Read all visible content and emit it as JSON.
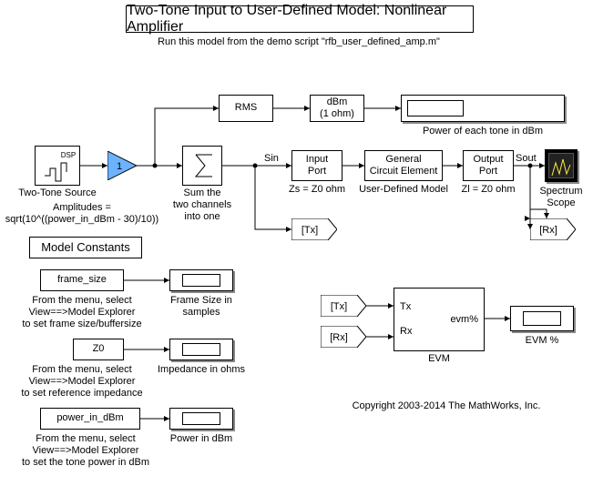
{
  "title": "Two-Tone Input to User-Defined Model: Nonlinear Amplifier",
  "subtitle": "Run this model from the demo script \"rfb_user_defined_amp.m\"",
  "blocks": {
    "twoTone": {
      "name": "Two-Tone Source",
      "note": "Amplitudes =\nsqrt(10^((power_in_dBm - 30)/10))",
      "badge": "DSP"
    },
    "gain": "1",
    "sum": {
      "name": "Sum the\ntwo channels\ninto one"
    },
    "rms": "RMS",
    "dbm": "dBm\n(1 ohm)",
    "dispPower": {
      "caption": "Power of each tone in dBm"
    },
    "inPort": {
      "name": "Input\nPort",
      "note": "Zs = Z0 ohm"
    },
    "ckt": {
      "name": "General\nCircuit Element",
      "note": "User-Defined Model"
    },
    "outPort": {
      "name": "Output\nPort",
      "note": "Zl = Z0 ohm"
    },
    "scope": {
      "name": "Spectrum\nScope"
    },
    "gotoTx": "[Tx]",
    "gotoRx": "[Rx]",
    "fromTx": "[Tx]",
    "fromRx": "[Rx]",
    "evm": {
      "name": "EVM",
      "tx": "Tx",
      "rx": "Rx",
      "out": "evm%"
    },
    "dispEvm": {
      "caption": "EVM %"
    },
    "sigSin": "Sin",
    "sigSout": "Sout"
  },
  "constants_title": "Model Constants",
  "constants": {
    "frame": {
      "param": "frame_size",
      "caption": "Frame Size in samples",
      "note": "From the menu, select\nView==>Model Explorer\nto set frame size/buffersize"
    },
    "z0": {
      "param": "Z0",
      "caption": "Impedance in ohms",
      "note": "From the menu, select\nView==>Model Explorer\nto set reference impedance"
    },
    "pow": {
      "param": "power_in_dBm",
      "caption": "Power in dBm",
      "note": "From the menu, select\nView==>Model Explorer\nto set the tone power in dBm"
    }
  },
  "copyright": "Copyright 2003-2014 The MathWorks, Inc."
}
